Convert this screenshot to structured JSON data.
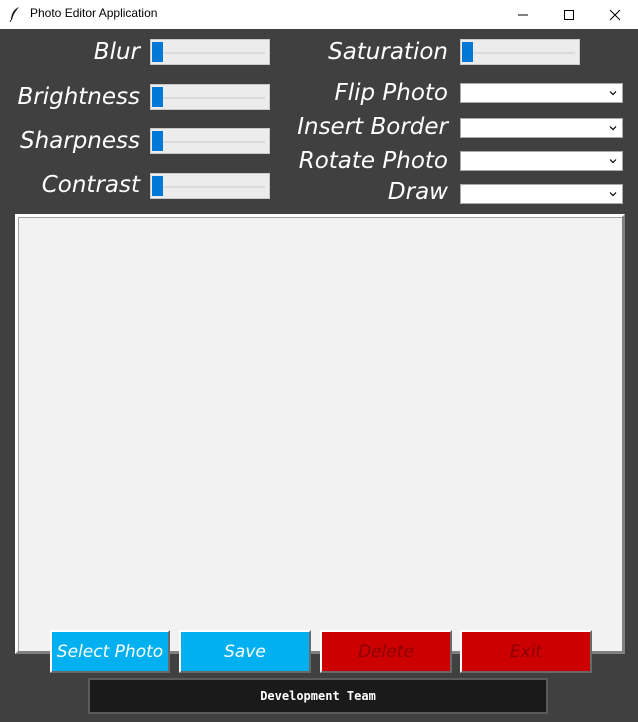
{
  "window": {
    "title": "Photo Editor Application"
  },
  "sliders": {
    "blur": {
      "label": "Blur",
      "value": 0
    },
    "brightness": {
      "label": "Brightness",
      "value": 0
    },
    "sharpness": {
      "label": "Sharpness",
      "value": 0
    },
    "contrast": {
      "label": "Contrast",
      "value": 0
    },
    "saturation": {
      "label": "Saturation",
      "value": 0
    }
  },
  "dropdowns": {
    "flip": {
      "label": "Flip Photo",
      "value": ""
    },
    "border": {
      "label": "Insert Border",
      "value": ""
    },
    "rotate": {
      "label": "Rotate Photo",
      "value": ""
    },
    "draw": {
      "label": "Draw",
      "value": ""
    }
  },
  "buttons": {
    "select": "Select Photo",
    "save": "Save",
    "delete": "Delete",
    "exit": "Exit"
  },
  "footer": {
    "label": "Development Team"
  },
  "colors": {
    "background": "#404040",
    "accent_blue": "#00b0f0",
    "danger_red": "#cc0000",
    "slider_thumb": "#0078d7"
  },
  "icons": [
    "feather-icon",
    "minimize-icon",
    "maximize-icon",
    "close-icon",
    "chevron-down-icon"
  ]
}
